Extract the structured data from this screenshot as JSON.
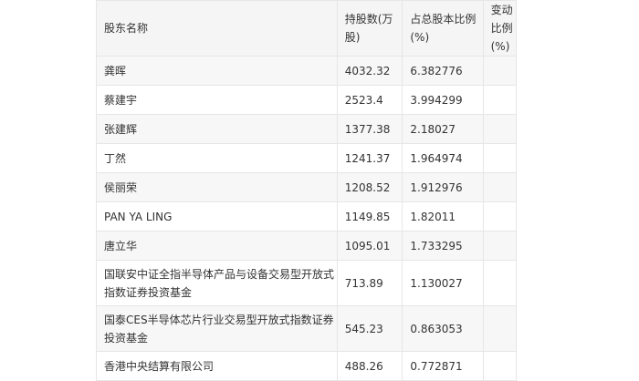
{
  "table": {
    "headers": [
      "股东名称",
      "持股数(万股)",
      "占总股本比例(%)",
      "变动比例(%)"
    ],
    "rows": [
      {
        "name": "龚晖",
        "shares": "4032.32",
        "ratio": "6.382776",
        "change": ""
      },
      {
        "name": "蔡建宇",
        "shares": "2523.4",
        "ratio": "3.994299",
        "change": ""
      },
      {
        "name": "张建辉",
        "shares": "1377.38",
        "ratio": "2.18027",
        "change": ""
      },
      {
        "name": "丁然",
        "shares": "1241.37",
        "ratio": "1.964974",
        "change": ""
      },
      {
        "name": "侯丽荣",
        "shares": "1208.52",
        "ratio": "1.912976",
        "change": ""
      },
      {
        "name": "PAN YA LING",
        "shares": "1149.85",
        "ratio": "1.82011",
        "change": ""
      },
      {
        "name": "唐立华",
        "shares": "1095.01",
        "ratio": "1.733295",
        "change": ""
      },
      {
        "name": "国联安中证全指半导体产品与设备交易型开放式指数证券投资基金",
        "shares": "713.89",
        "ratio": "1.130027",
        "change": ""
      },
      {
        "name": "国泰CES半导体芯片行业交易型开放式指数证券投资基金",
        "shares": "545.23",
        "ratio": "0.863053",
        "change": ""
      },
      {
        "name": "香港中央结算有限公司",
        "shares": "488.26",
        "ratio": "0.772871",
        "change": ""
      }
    ]
  }
}
